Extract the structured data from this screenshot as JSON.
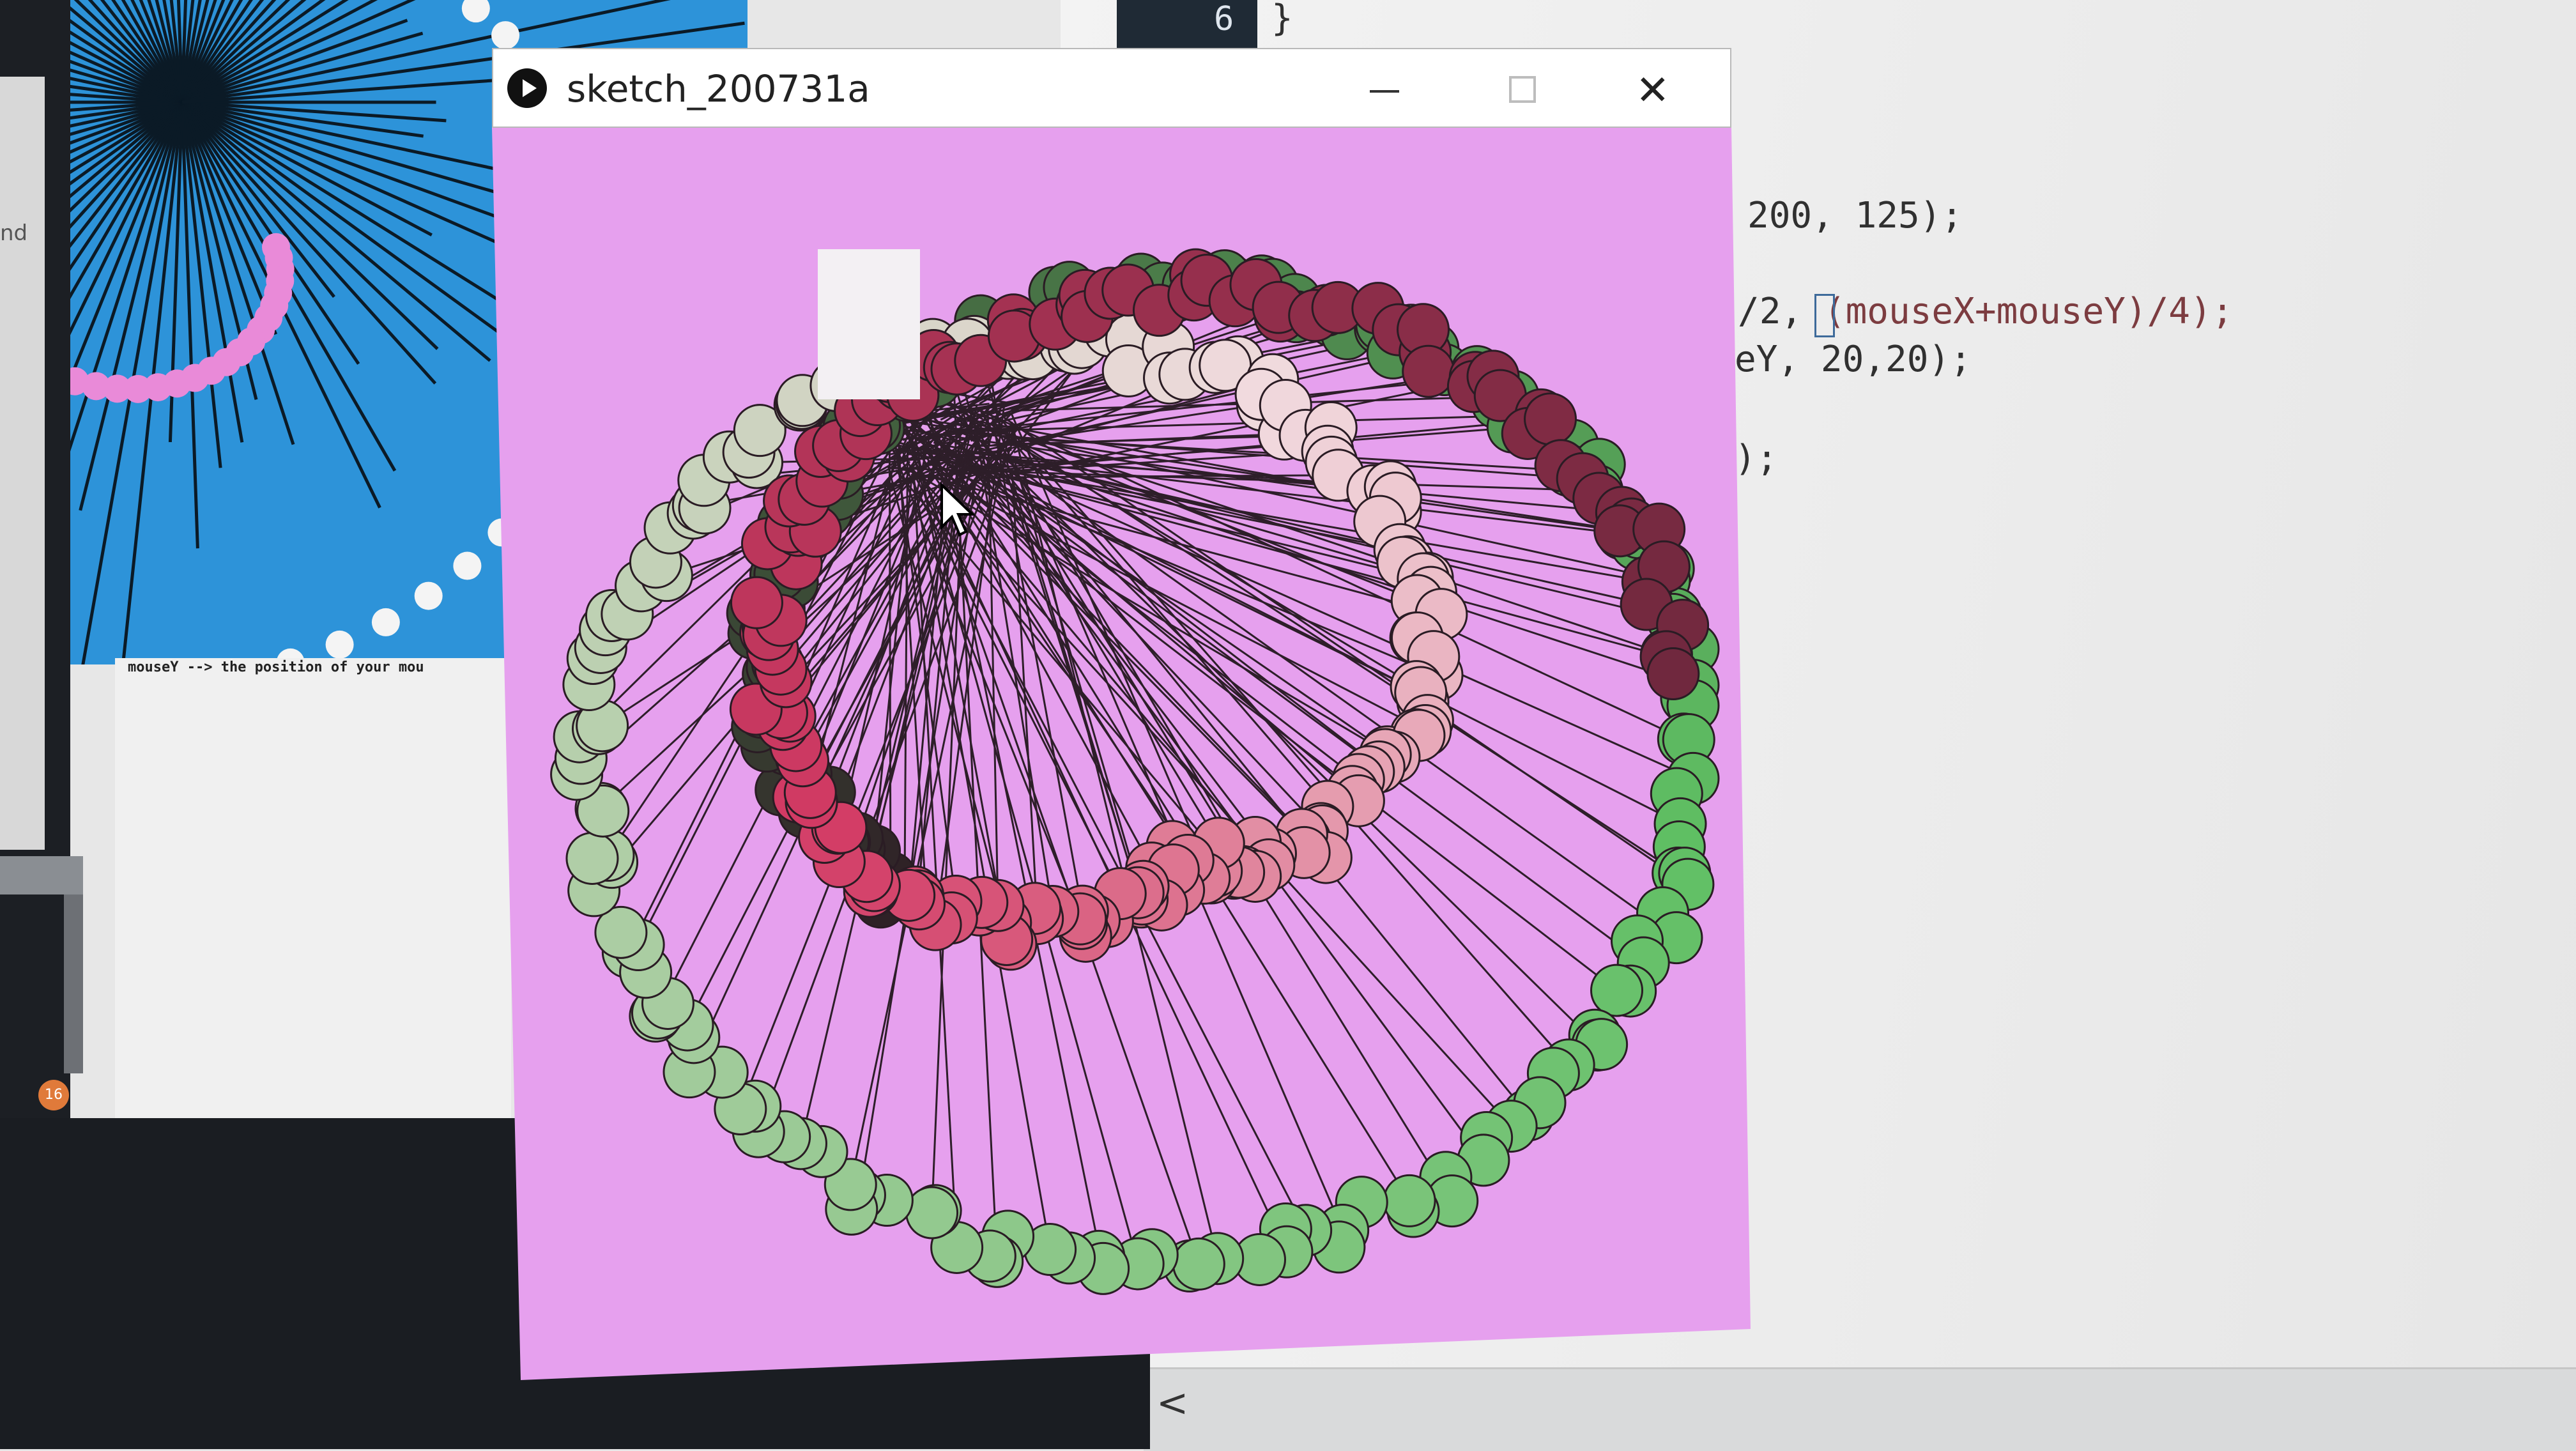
{
  "editor": {
    "line_number": "6",
    "line6_text": "}",
    "code_lines": [
      "200, 125);",
      "/2, (mouseX+mouseY)/4);",
      "eY, 20,20);",
      ");"
    ],
    "code_line2_pre": "/2, ",
    "code_line2_str": "(mouseX+mouseY)/4);",
    "scroll_left_icon": "<"
  },
  "background_window": {
    "side_label": "nd",
    "console_text": "mouseY --> the position of your mou",
    "badge": "16"
  },
  "sketch_window": {
    "title": "sketch_200731a",
    "icon": "play-icon",
    "buttons": {
      "minimize": "minimize-icon",
      "maximize": "maximize-icon",
      "close": "close-icon"
    },
    "canvas_background": "#e6a0ee"
  },
  "colors": {
    "blue_canvas": "#2d93d9",
    "sketch_bg": "#e6a0ee",
    "circle_dark": "#2b1a24",
    "circle_green": "#5fbf63",
    "circle_red": "#d23a64",
    "circle_pale": "#f1dade"
  }
}
